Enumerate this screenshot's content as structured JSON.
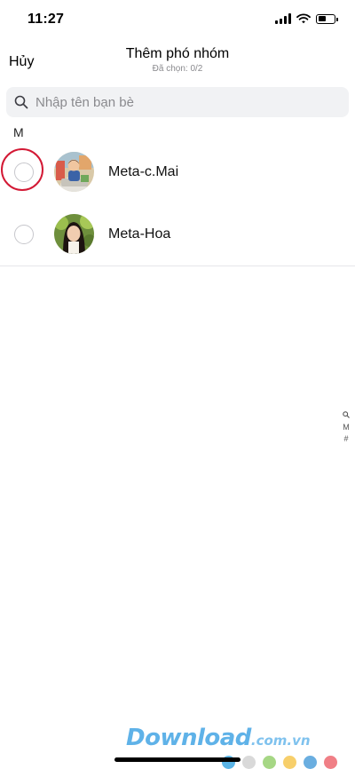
{
  "status": {
    "time": "11:27",
    "battery_level": 0.45
  },
  "nav": {
    "cancel_label": "Hủy",
    "title": "Thêm phó nhóm",
    "subtitle": "Đã chọn: 0/2"
  },
  "search": {
    "placeholder": "Nhập tên bạn bè",
    "value": ""
  },
  "section": {
    "header": "M"
  },
  "contacts": [
    {
      "name": "Meta-c.Mai",
      "selected": false
    },
    {
      "name": "Meta-Hoa",
      "selected": false
    }
  ],
  "index_bar": {
    "search_icon": "search-icon",
    "letters": [
      "M",
      "#"
    ]
  },
  "watermark": {
    "main": "Download",
    "sub": ".com.vn",
    "dot_colors": [
      "#5ab4e6",
      "#d9d9d9",
      "#a6d785",
      "#f7cf6b",
      "#6aaee0",
      "#f07f86"
    ]
  },
  "colors": {
    "highlight": "#d31935",
    "search_bg": "#f1f2f4",
    "divider": "#e5e5ea"
  }
}
